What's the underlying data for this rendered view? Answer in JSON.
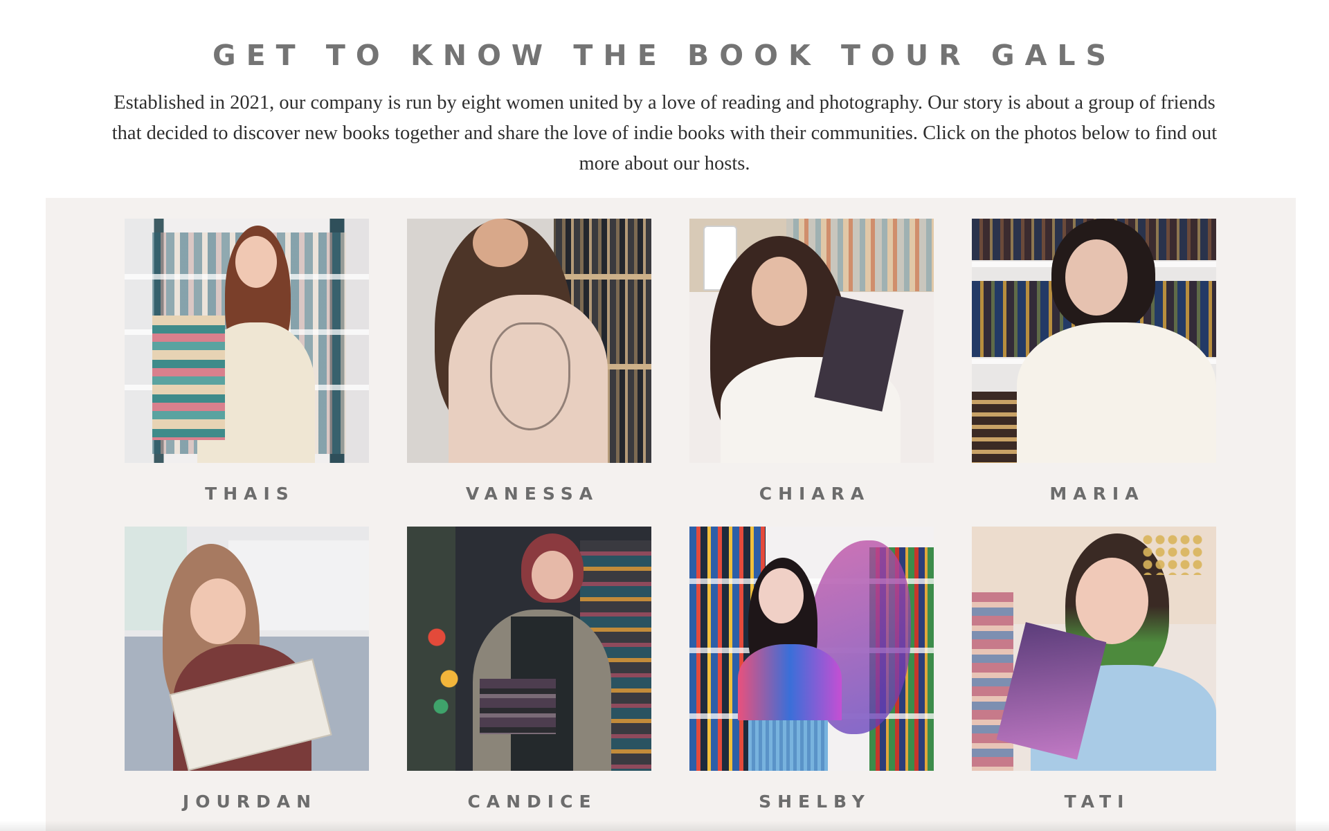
{
  "page": {
    "heading": "GET TO KNOW THE BOOK TOUR GALS",
    "intro": "Established in 2021, our company is run by eight women united by a love of reading and photography. Our story is about a group of friends that decided to discover new books together and share the love of indie books with their communities. Click on the photos below to find out more about our hosts."
  },
  "hosts": [
    {
      "name": "THAIS",
      "photo_icon": "host-photo-thais"
    },
    {
      "name": "VANESSA",
      "photo_icon": "host-photo-vanessa"
    },
    {
      "name": "CHIARA",
      "photo_icon": "host-photo-chiara"
    },
    {
      "name": "MARIA",
      "photo_icon": "host-photo-maria"
    },
    {
      "name": "JOURDAN",
      "photo_icon": "host-photo-jourdan"
    },
    {
      "name": "CANDICE",
      "photo_icon": "host-photo-candice"
    },
    {
      "name": "SHELBY",
      "photo_icon": "host-photo-shelby"
    },
    {
      "name": "TATI",
      "photo_icon": "host-photo-tati"
    }
  ],
  "colors": {
    "heading": "#747474",
    "panel_background": "#f4f1ef",
    "name_text": "#6c6c6c"
  }
}
